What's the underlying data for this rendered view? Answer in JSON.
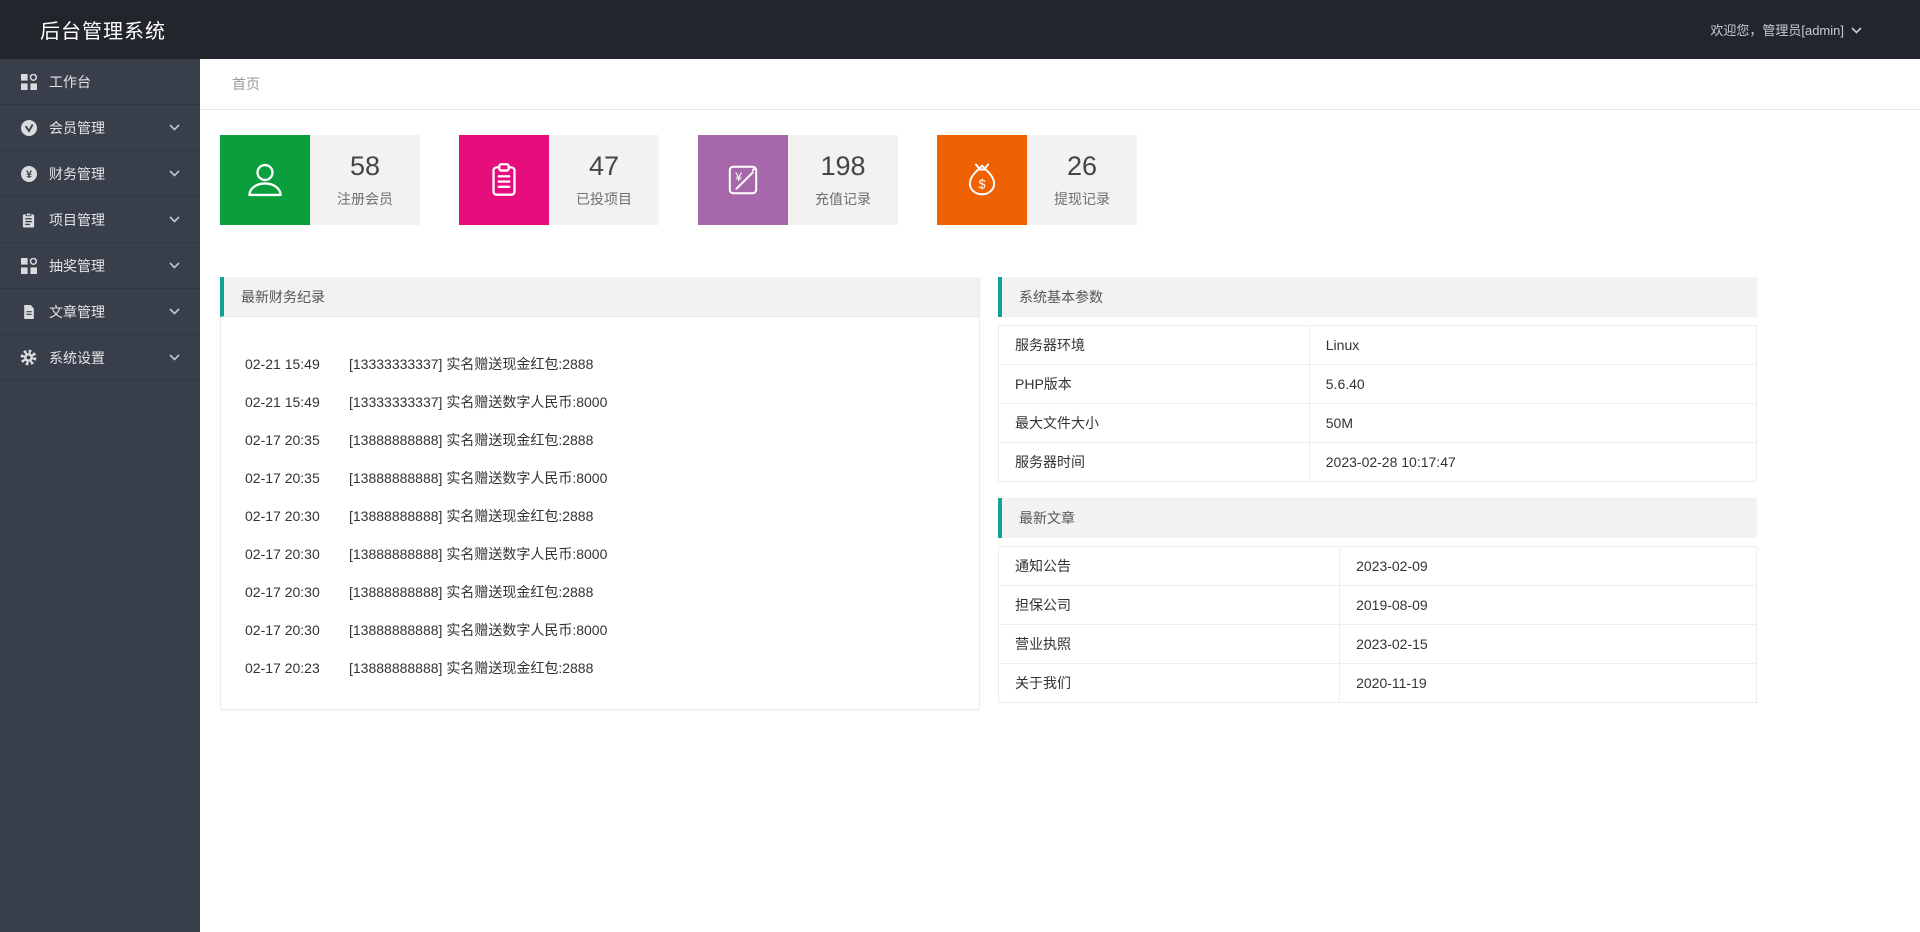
{
  "topbar": {
    "title": "后台管理系统",
    "welcome": "欢迎您，管理员[admin]"
  },
  "breadcrumb": {
    "home": "首页"
  },
  "sidebar": {
    "items": [
      {
        "label": "工作台",
        "icon": "grid-icon",
        "chevron": false
      },
      {
        "label": "会员管理",
        "icon": "member-check-icon",
        "chevron": true
      },
      {
        "label": "财务管理",
        "icon": "yuan-circle-icon",
        "chevron": true
      },
      {
        "label": "项目管理",
        "icon": "clipboard-icon",
        "chevron": true
      },
      {
        "label": "抽奖管理",
        "icon": "grid-icon",
        "chevron": true
      },
      {
        "label": "文章管理",
        "icon": "document-icon",
        "chevron": true
      },
      {
        "label": "系统设置",
        "icon": "gear-icon",
        "chevron": true
      }
    ]
  },
  "stats": [
    {
      "value": "58",
      "label": "注册会员",
      "color": "#0b9e3d",
      "icon": "user-icon"
    },
    {
      "value": "47",
      "label": "已投项目",
      "color": "#e60d7d",
      "icon": "clipboard-icon"
    },
    {
      "value": "198",
      "label": "充值记录",
      "color": "#a768ab",
      "icon": "recharge-card-icon"
    },
    {
      "value": "26",
      "label": "提现记录",
      "color": "#ee6203",
      "icon": "money-bag-icon"
    }
  ],
  "finance_panel": {
    "title": "最新财务纪录",
    "records": [
      {
        "time": "02-21 15:49",
        "text": "[13333333337] 实名赠送现金红包:2888"
      },
      {
        "time": "02-21 15:49",
        "text": "[13333333337] 实名赠送数字人民币:8000"
      },
      {
        "time": "02-17 20:35",
        "text": "[13888888888] 实名赠送现金红包:2888"
      },
      {
        "time": "02-17 20:35",
        "text": "[13888888888] 实名赠送数字人民币:8000"
      },
      {
        "time": "02-17 20:30",
        "text": "[13888888888] 实名赠送现金红包:2888"
      },
      {
        "time": "02-17 20:30",
        "text": "[13888888888] 实名赠送数字人民币:8000"
      },
      {
        "time": "02-17 20:30",
        "text": "[13888888888] 实名赠送现金红包:2888"
      },
      {
        "time": "02-17 20:30",
        "text": "[13888888888] 实名赠送数字人民币:8000"
      },
      {
        "time": "02-17 20:23",
        "text": "[13888888888] 实名赠送现金红包:2888"
      }
    ]
  },
  "system_panel": {
    "title": "系统基本参数",
    "rows": [
      {
        "label": "服务器环境",
        "value": "Linux"
      },
      {
        "label": "PHP版本",
        "value": "5.6.40"
      },
      {
        "label": "最大文件大小",
        "value": "50M"
      },
      {
        "label": "服务器时间",
        "value": "2023-02-28 10:17:47"
      }
    ]
  },
  "articles_panel": {
    "title": "最新文章",
    "rows": [
      {
        "label": "通知公告",
        "value": "2023-02-09"
      },
      {
        "label": "担保公司",
        "value": "2019-08-09"
      },
      {
        "label": "营业执照",
        "value": "2023-02-15"
      },
      {
        "label": "关于我们",
        "value": "2020-11-19"
      }
    ]
  },
  "colors": {
    "topbar_bg": "#22252c",
    "sidebar_bg": "#383f4a",
    "accent_teal": "#12a195",
    "stat_green": "#0b9e3d",
    "stat_pink": "#e60d7d",
    "stat_purple": "#a768ab",
    "stat_orange": "#ee6203",
    "panel_header_bg": "#f2f2f2"
  }
}
